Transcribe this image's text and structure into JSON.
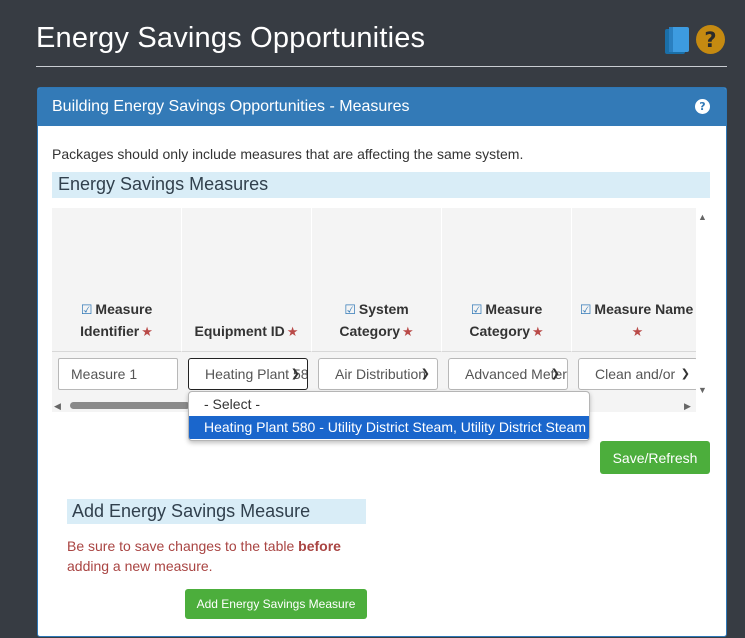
{
  "page": {
    "title": "Energy Savings Opportunities",
    "icons": {
      "book": "book-icon",
      "help": "question-circle-icon"
    },
    "colors": {
      "background": "#373c43",
      "panel_header": "#337ab7",
      "success_button": "#4cae3c",
      "accent_help": "#c58a11"
    }
  },
  "panel": {
    "title": "Building Energy Savings Opportunities - Measures",
    "help_glyph": "?",
    "intro": "Packages should only include measures that are affecting the same system."
  },
  "measures_section": {
    "title": "Energy Savings Measures",
    "columns": [
      {
        "label": "Measure Identifier",
        "checked": true,
        "required": true
      },
      {
        "label": "Equipment ID",
        "checked": false,
        "required": true
      },
      {
        "label": "System Category",
        "checked": true,
        "required": true
      },
      {
        "label": "Measure Category",
        "checked": true,
        "required": true
      },
      {
        "label": "Measure Name",
        "checked": true,
        "required": true
      }
    ],
    "row": {
      "measure_identifier": "Measure 1",
      "equipment_id": "Heating Plant 580 - Utility District Steam, Utility District Steam",
      "system_category": "Air Distribution",
      "measure_category": "Advanced Metering",
      "measure_name": "Clean and/or"
    },
    "dropdown_options": [
      {
        "label": "- Select -",
        "selected": false
      },
      {
        "label": "Heating Plant 580 - Utility District Steam, Utility District Steam",
        "selected": true
      }
    ],
    "save_button": "Save/Refresh"
  },
  "add_section": {
    "title": "Add Energy Savings Measure",
    "warning_prefix": "Be sure to save changes to the table ",
    "warning_bold": "before",
    "warning_suffix": " adding a new measure.",
    "button": "Add Energy Savings Measure"
  }
}
